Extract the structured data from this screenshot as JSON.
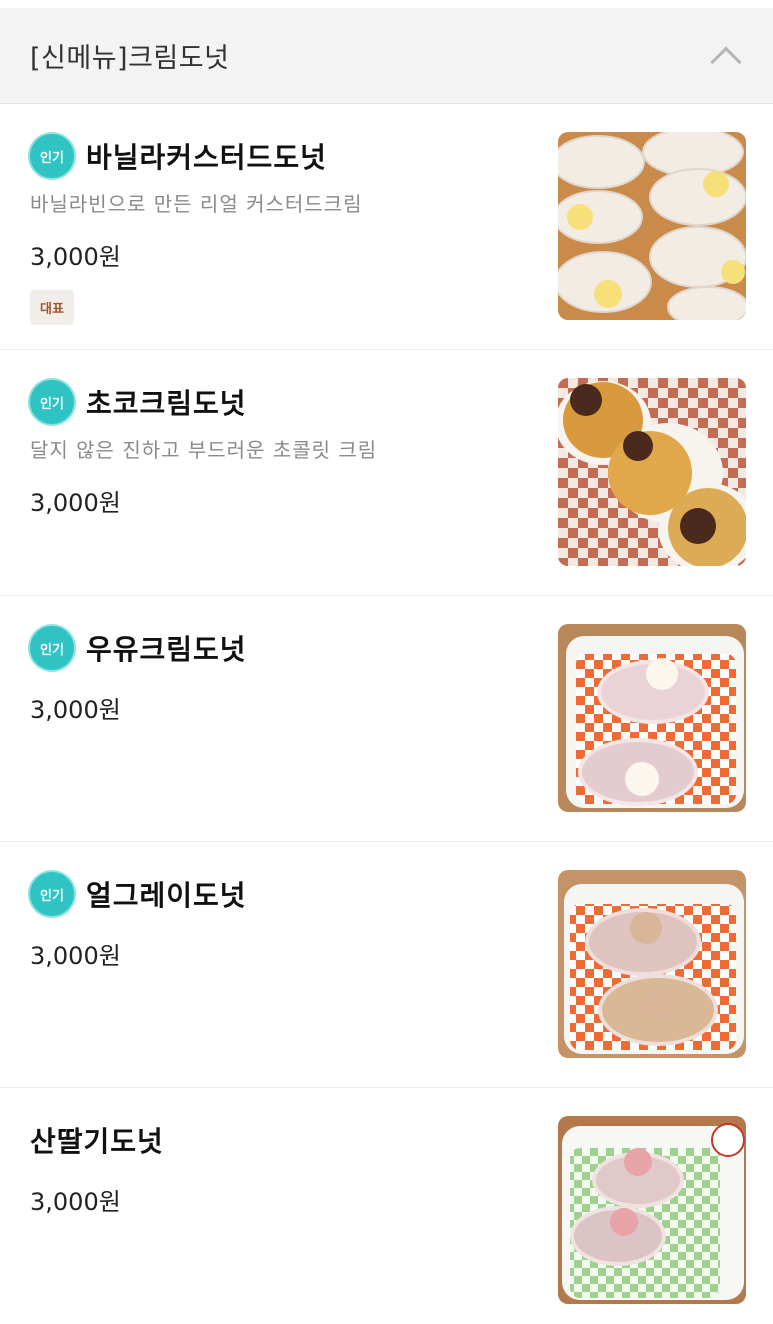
{
  "section": {
    "title": "[신메뉴]크림도넛",
    "toggle_icon": "chevron-up-icon"
  },
  "items": [
    {
      "badge": "인기",
      "name": "바닐라커스터드도넛",
      "description": "바닐라빈으로 만든 리얼 커스터드크림",
      "price": "3,000원",
      "tag": "대표",
      "image_icon": "vanilla-custard-donut-photo",
      "cream_color": "#f7df7a"
    },
    {
      "badge": "인기",
      "name": "초코크림도넛",
      "description": "달지 않은 진하고 부드러운 초콜릿 크림",
      "price": "3,000원",
      "image_icon": "choco-cream-donut-photo",
      "cream_color": "#4a2a1c"
    },
    {
      "badge": "인기",
      "name": "우유크림도넛",
      "price": "3,000원",
      "image_icon": "milk-cream-donut-photo",
      "cream_color": "#fbf7ef"
    },
    {
      "badge": "인기",
      "name": "얼그레이도넛",
      "price": "3,000원",
      "image_icon": "earl-grey-donut-photo",
      "cream_color": "#d9b59a"
    },
    {
      "name": "산딸기도넛",
      "price": "3,000원",
      "image_icon": "raspberry-donut-photo",
      "cream_color": "#e6a3a8"
    }
  ],
  "colors": {
    "badge": "#2fc3c3",
    "tag_text": "#a0562a",
    "header_bg": "#f3f3f3"
  }
}
